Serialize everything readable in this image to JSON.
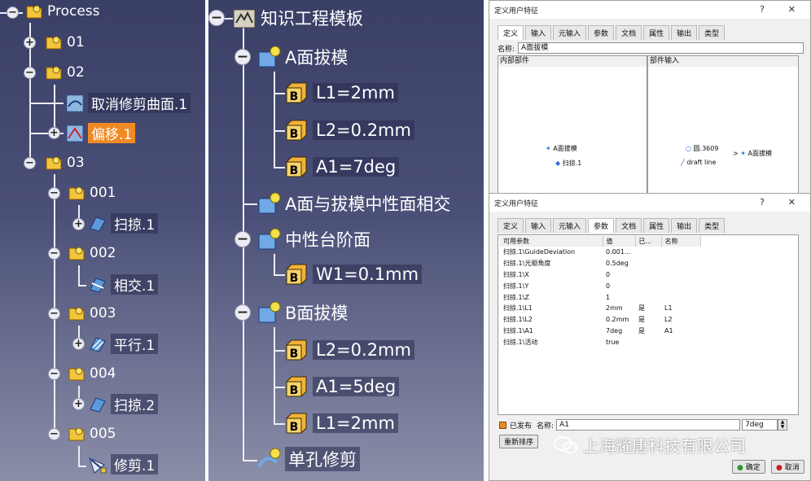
{
  "tree_left": {
    "root": "Process",
    "items": [
      {
        "label": "01"
      },
      {
        "label": "02"
      },
      {
        "label": "取消修剪曲面.1"
      },
      {
        "label": "偏移.1"
      },
      {
        "label": "03"
      },
      {
        "label": "001"
      },
      {
        "label": "扫掠.1"
      },
      {
        "label": "002"
      },
      {
        "label": "相交.1"
      },
      {
        "label": "003"
      },
      {
        "label": "平行.1"
      },
      {
        "label": "004"
      },
      {
        "label": "扫掠.2"
      },
      {
        "label": "005"
      },
      {
        "label": "修剪.1"
      }
    ]
  },
  "tree_right": {
    "root": "知识工程模板",
    "items": [
      {
        "label": "A面拔模"
      },
      {
        "label": "L1=2mm"
      },
      {
        "label": "L2=0.2mm"
      },
      {
        "label": "A1=7deg"
      },
      {
        "label": "A面与拔模中性面相交"
      },
      {
        "label": "中性台阶面"
      },
      {
        "label": "W1=0.1mm"
      },
      {
        "label": "B面拔模"
      },
      {
        "label": "L2=0.2mm"
      },
      {
        "label": "A1=5deg"
      },
      {
        "label": "L1=2mm"
      },
      {
        "label": "单孔修剪"
      }
    ]
  },
  "dialog_top": {
    "title": "定义用户特征",
    "help": "?",
    "close": "✕",
    "tabs": [
      "定义",
      "输入",
      "元输入",
      "参数",
      "文档",
      "属性",
      "输出",
      "类型"
    ],
    "name_label": "名称:",
    "name_value": "A面拔模",
    "internal_label": "内部部件",
    "inputs_label": "部件输入",
    "internal_node": "A面拔模",
    "internal_child": "扫掠.1",
    "input_circle": "圆.3609",
    "input_line": "draft line",
    "input_target": "A面拔模"
  },
  "dialog_bottom": {
    "title": "定义用户特征",
    "help": "?",
    "close": "✕",
    "tabs": [
      "定义",
      "输入",
      "元输入",
      "参数",
      "文档",
      "属性",
      "输出",
      "类型"
    ],
    "columns": [
      "可用参数",
      "值",
      "已...",
      "名称"
    ],
    "rows": [
      [
        "扫掠.1\\GuideDeviation",
        "0.001...",
        "",
        ""
      ],
      [
        "扫掠.1\\光顺角度",
        "0.5deg",
        "",
        ""
      ],
      [
        "扫掠.1\\X",
        "0",
        "",
        ""
      ],
      [
        "扫掠.1\\Y",
        "0",
        "",
        ""
      ],
      [
        "扫掠.1\\Z",
        "1",
        "",
        ""
      ],
      [
        "扫掠.1\\L1",
        "2mm",
        "是",
        "L1"
      ],
      [
        "扫掠.1\\L2",
        "0.2mm",
        "是",
        "L2"
      ],
      [
        "扫掠.1\\A1",
        "7deg",
        "是",
        "A1"
      ],
      [
        "扫掠.1\\活动",
        "true",
        "",
        ""
      ]
    ],
    "published_label": "已发布",
    "name_label": "名称:",
    "name_value": "A1",
    "value_field": "7deg",
    "rename_button": "重新排序",
    "ok_button": "确定",
    "cancel_button": "取消"
  },
  "watermark": "上海耀唐科技有限公司",
  "colors": {
    "selection": "#f08a24",
    "panel": "#3a3f66"
  }
}
